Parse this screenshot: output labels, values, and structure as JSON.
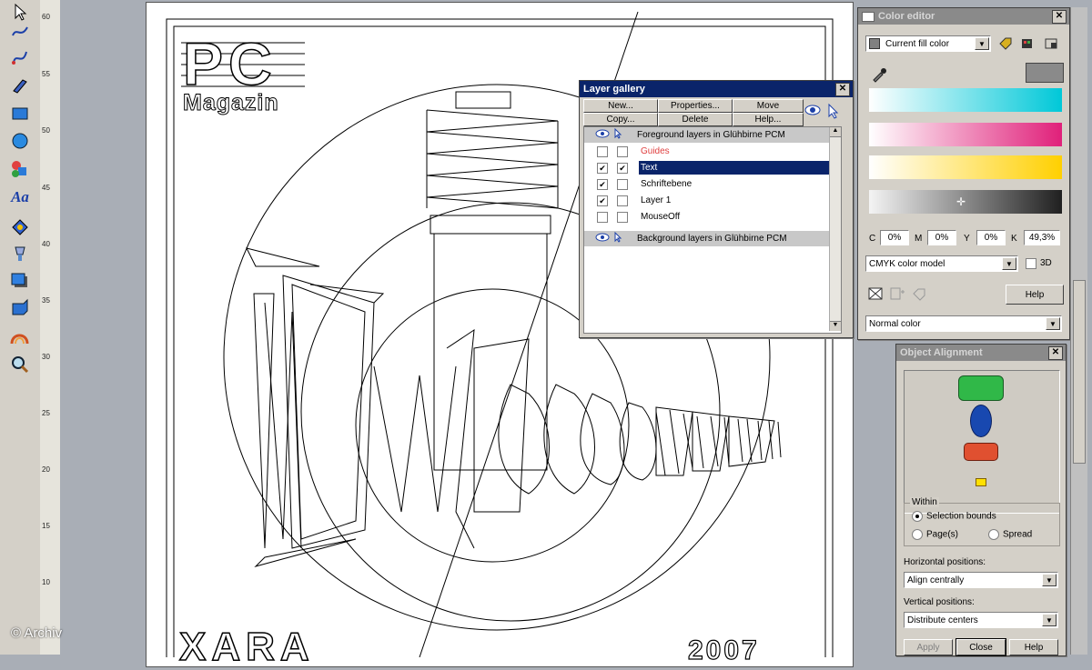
{
  "toolbar": {
    "tools": [
      "selector-tool",
      "freehand-tool",
      "bezier-tool",
      "pen-tool",
      "rectangle-tool",
      "ellipse-tool",
      "shape-tool",
      "text-tool",
      "fill-tool",
      "transparency-tool",
      "shadow-tool",
      "extrude-tool",
      "blend-tool",
      "zoom-tool"
    ],
    "text_tool_glyph": "Aa"
  },
  "ruler": {
    "ticks": [
      "60",
      "55",
      "50",
      "45",
      "40",
      "35",
      "30",
      "25",
      "20",
      "15",
      "10"
    ]
  },
  "artwork": {
    "logo_pc": "PC",
    "logo_magazin": "Magazin",
    "bottom_text": "XARA",
    "bottom_year": "2007"
  },
  "layer_gallery": {
    "title": "Layer gallery",
    "buttons": {
      "new": "New...",
      "properties": "Properties...",
      "move": "Move",
      "copy": "Copy...",
      "delete": "Delete",
      "help": "Help..."
    },
    "foreground_group": "Foreground layers in Glühbirne PCM",
    "layers": [
      {
        "name": "Guides",
        "visible": false,
        "locked": false,
        "color": "#e04040"
      },
      {
        "name": "Text",
        "visible": true,
        "locked": true,
        "selected": true
      },
      {
        "name": "Schriftebene",
        "visible": true,
        "locked": false
      },
      {
        "name": "Layer 1",
        "visible": true,
        "locked": false
      },
      {
        "name": "MouseOff",
        "visible": false,
        "locked": false
      }
    ],
    "background_group": "Background layers in Glühbirne PCM"
  },
  "color_editor": {
    "title": "Color editor",
    "fill_select": "Current fill color",
    "c_label": "C",
    "c_value": "0%",
    "m_label": "M",
    "m_value": "0%",
    "y_label": "Y",
    "y_value": "0%",
    "k_label": "K",
    "k_value": "49,3%",
    "model": "CMYK color model",
    "three_d": "3D",
    "help": "Help",
    "color_type": "Normal color",
    "colors": {
      "cyan": "#00c8d8",
      "magenta": "#e0207a",
      "yellow": "#ffd000"
    }
  },
  "object_alignment": {
    "title": "Object Alignment",
    "within_label": "Within",
    "selection_bounds": "Selection bounds",
    "pages": "Page(s)",
    "spread": "Spread",
    "horizontal_label": "Horizontal positions:",
    "horizontal_value": "Align centrally",
    "vertical_label": "Vertical positions:",
    "vertical_value": "Distribute centers",
    "apply": "Apply",
    "close": "Close",
    "help": "Help"
  },
  "watermark": "© Archiv"
}
